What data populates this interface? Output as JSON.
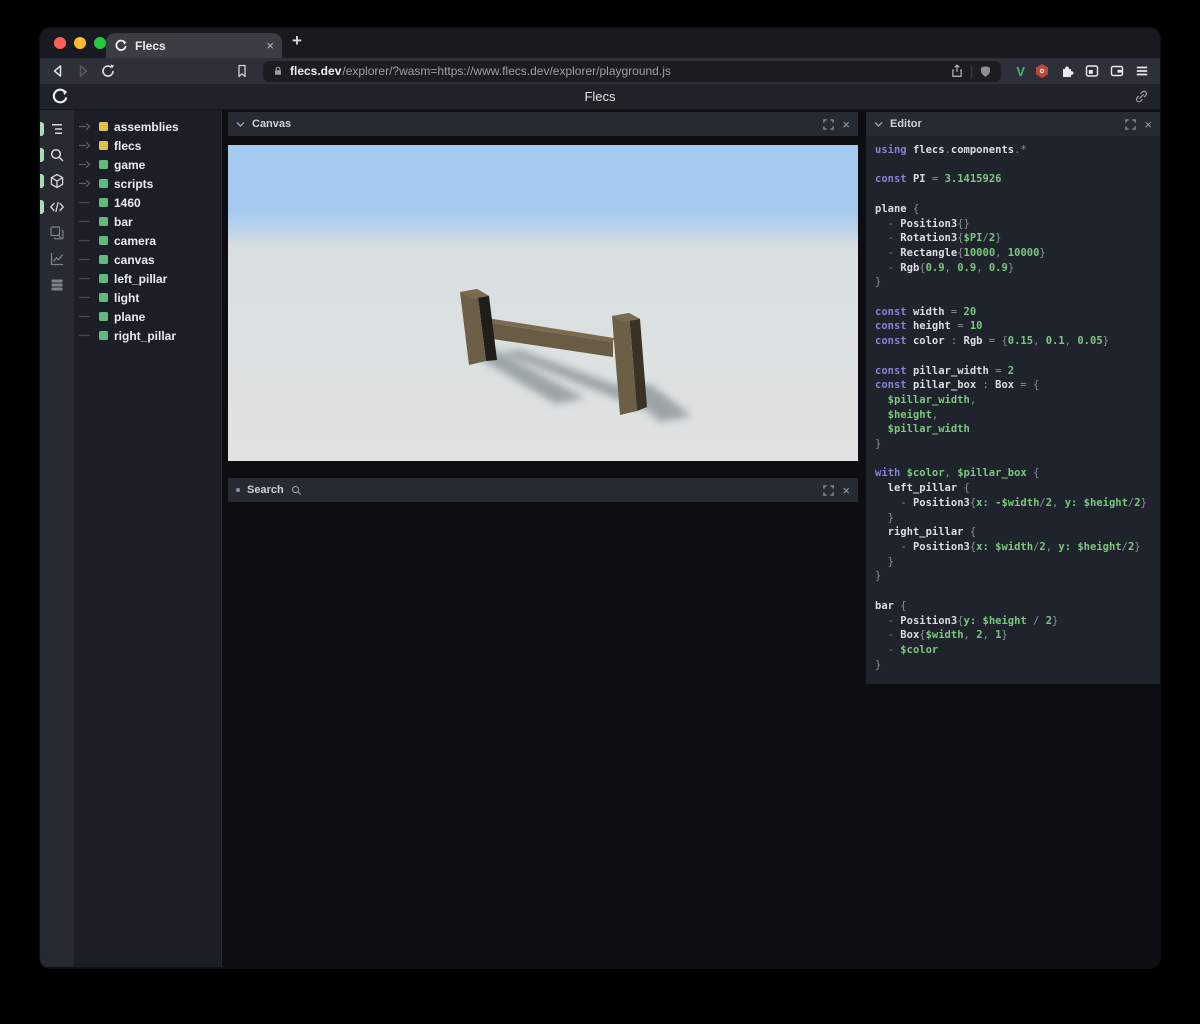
{
  "browser": {
    "tab_title": "Flecs",
    "tab_close": "×",
    "new_tab": "+",
    "url_domain": "flecs.dev",
    "url_rest": "/explorer/?wasm=https://www.flecs.dev/explorer/playground.js",
    "url_divider": "|",
    "vue_badge": "V",
    "icons": [
      "back",
      "forward",
      "reload",
      "bookmark",
      "lock",
      "share",
      "shield",
      "vue-devtools",
      "adblock-extension",
      "extensions-puzzle",
      "sidebar",
      "wallet",
      "menu"
    ],
    "traffic_lights": {
      "close": "#ff5f57",
      "minimize": "#febc2e",
      "zoom": "#28c840"
    }
  },
  "header": {
    "title": "Flecs",
    "icons": [
      "flecs-logo",
      "link"
    ]
  },
  "rail": {
    "items": [
      {
        "name": "tree-outline",
        "active": true
      },
      {
        "name": "search",
        "active": true
      },
      {
        "name": "cube",
        "active": true
      },
      {
        "name": "code",
        "active": true
      },
      {
        "name": "inspect",
        "active": false
      },
      {
        "name": "chart",
        "active": false
      },
      {
        "name": "rows",
        "active": false
      }
    ]
  },
  "tree": {
    "items": [
      {
        "label": "assemblies",
        "square": "#e2c04c",
        "expandable": true
      },
      {
        "label": "flecs",
        "square": "#e2c04c",
        "expandable": true
      },
      {
        "label": "game",
        "square": "#61ba7c",
        "expandable": true
      },
      {
        "label": "scripts",
        "square": "#61ba7c",
        "expandable": true
      },
      {
        "label": "1460",
        "square": "#61ba7c",
        "expandable": false
      },
      {
        "label": "bar",
        "square": "#61ba7c",
        "expandable": false
      },
      {
        "label": "camera",
        "square": "#61ba7c",
        "expandable": false
      },
      {
        "label": "canvas",
        "square": "#61ba7c",
        "expandable": false
      },
      {
        "label": "left_pillar",
        "square": "#61ba7c",
        "expandable": false
      },
      {
        "label": "light",
        "square": "#61ba7c",
        "expandable": false
      },
      {
        "label": "plane",
        "square": "#61ba7c",
        "expandable": false
      },
      {
        "label": "right_pillar",
        "square": "#61ba7c",
        "expandable": false
      }
    ]
  },
  "panels": {
    "canvas_title": "Canvas",
    "search_title": "Search",
    "editor_title": "Editor",
    "close_glyph": "×",
    "header_icons": [
      "chevron-down",
      "fullscreen",
      "close",
      "magnifier"
    ]
  },
  "scene": {
    "sky": "#a5caf0",
    "ground": "#dde2e0",
    "wood_front": "#6c5f47",
    "wood_dark": "#201e18",
    "wood_side": "#393325",
    "wood_top": "#7a6b50",
    "shadow": "#5b6670"
  },
  "code": {
    "colors": {
      "keyword": "#8583d6",
      "identifier": "#dcdde2",
      "punct": "#8b909a",
      "value": "#7cc87f"
    },
    "lines": [
      [
        [
          "k",
          "using "
        ],
        [
          "i",
          "flecs"
        ],
        [
          "o",
          "."
        ],
        [
          "i",
          "components"
        ],
        [
          "o",
          ".*"
        ]
      ],
      [],
      [
        [
          "k",
          "const "
        ],
        [
          "i",
          "PI"
        ],
        [
          "o",
          " = "
        ],
        [
          "g",
          "3.1415926"
        ]
      ],
      [],
      [
        [
          "i",
          "plane"
        ],
        [
          "o",
          " {"
        ]
      ],
      [
        [
          "o",
          "  - "
        ],
        [
          "i",
          "Position3"
        ],
        [
          "o",
          "{}"
        ]
      ],
      [
        [
          "o",
          "  - "
        ],
        [
          "i",
          "Rotation3"
        ],
        [
          "o",
          "{"
        ],
        [
          "g",
          "$PI"
        ],
        [
          "o",
          "/"
        ],
        [
          "g",
          "2"
        ],
        [
          "o",
          "}"
        ]
      ],
      [
        [
          "o",
          "  - "
        ],
        [
          "i",
          "Rectangle"
        ],
        [
          "o",
          "{"
        ],
        [
          "g",
          "10000"
        ],
        [
          "o",
          ", "
        ],
        [
          "g",
          "10000"
        ],
        [
          "o",
          "}"
        ]
      ],
      [
        [
          "o",
          "  - "
        ],
        [
          "i",
          "Rgb"
        ],
        [
          "o",
          "{"
        ],
        [
          "g",
          "0.9"
        ],
        [
          "o",
          ", "
        ],
        [
          "g",
          "0.9"
        ],
        [
          "o",
          ", "
        ],
        [
          "g",
          "0.9"
        ],
        [
          "o",
          "}"
        ]
      ],
      [
        [
          "o",
          "}"
        ]
      ],
      [],
      [
        [
          "k",
          "const "
        ],
        [
          "i",
          "width"
        ],
        [
          "o",
          " = "
        ],
        [
          "g",
          "20"
        ]
      ],
      [
        [
          "k",
          "const "
        ],
        [
          "i",
          "height"
        ],
        [
          "o",
          " = "
        ],
        [
          "g",
          "10"
        ]
      ],
      [
        [
          "k",
          "const "
        ],
        [
          "i",
          "color"
        ],
        [
          "o",
          " : "
        ],
        [
          "i",
          "Rgb"
        ],
        [
          "o",
          " = {"
        ],
        [
          "g",
          "0.15"
        ],
        [
          "o",
          ", "
        ],
        [
          "g",
          "0.1"
        ],
        [
          "o",
          ", "
        ],
        [
          "g",
          "0.05"
        ],
        [
          "o",
          "}"
        ]
      ],
      [],
      [
        [
          "k",
          "const "
        ],
        [
          "i",
          "pillar_width"
        ],
        [
          "o",
          " = "
        ],
        [
          "g",
          "2"
        ]
      ],
      [
        [
          "k",
          "const "
        ],
        [
          "i",
          "pillar_box"
        ],
        [
          "o",
          " : "
        ],
        [
          "i",
          "Box"
        ],
        [
          "o",
          " = {"
        ]
      ],
      [
        [
          "g",
          "  $pillar_width"
        ],
        [
          "o",
          ","
        ]
      ],
      [
        [
          "g",
          "  $height"
        ],
        [
          "o",
          ","
        ]
      ],
      [
        [
          "g",
          "  $pillar_width"
        ]
      ],
      [
        [
          "o",
          "}"
        ]
      ],
      [],
      [
        [
          "k",
          "with "
        ],
        [
          "g",
          "$color"
        ],
        [
          "o",
          ", "
        ],
        [
          "g",
          "$pillar_box"
        ],
        [
          "o",
          " {"
        ]
      ],
      [
        [
          "i",
          "  left_pillar"
        ],
        [
          "o",
          " {"
        ]
      ],
      [
        [
          "o",
          "    - "
        ],
        [
          "i",
          "Position3"
        ],
        [
          "o",
          "{"
        ],
        [
          "g",
          "x: -$width"
        ],
        [
          "o",
          "/"
        ],
        [
          "g",
          "2"
        ],
        [
          "o",
          ", "
        ],
        [
          "g",
          "y: $height"
        ],
        [
          "o",
          "/"
        ],
        [
          "g",
          "2"
        ],
        [
          "o",
          "}"
        ]
      ],
      [
        [
          "o",
          "  }"
        ]
      ],
      [
        [
          "i",
          "  right_pillar"
        ],
        [
          "o",
          " {"
        ]
      ],
      [
        [
          "o",
          "    - "
        ],
        [
          "i",
          "Position3"
        ],
        [
          "o",
          "{"
        ],
        [
          "g",
          "x: $width"
        ],
        [
          "o",
          "/"
        ],
        [
          "g",
          "2"
        ],
        [
          "o",
          ", "
        ],
        [
          "g",
          "y: $height"
        ],
        [
          "o",
          "/"
        ],
        [
          "g",
          "2"
        ],
        [
          "o",
          "}"
        ]
      ],
      [
        [
          "o",
          "  }"
        ]
      ],
      [
        [
          "o",
          "}"
        ]
      ],
      [],
      [
        [
          "i",
          "bar"
        ],
        [
          "o",
          " {"
        ]
      ],
      [
        [
          "o",
          "  - "
        ],
        [
          "i",
          "Position3"
        ],
        [
          "o",
          "{"
        ],
        [
          "g",
          "y: $height"
        ],
        [
          "o",
          " / "
        ],
        [
          "g",
          "2"
        ],
        [
          "o",
          "}"
        ]
      ],
      [
        [
          "o",
          "  - "
        ],
        [
          "i",
          "Box"
        ],
        [
          "o",
          "{"
        ],
        [
          "g",
          "$width"
        ],
        [
          "o",
          ", "
        ],
        [
          "g",
          "2"
        ],
        [
          "o",
          ", "
        ],
        [
          "g",
          "1"
        ],
        [
          "o",
          "}"
        ]
      ],
      [
        [
          "o",
          "  - "
        ],
        [
          "g",
          "$color"
        ]
      ],
      [
        [
          "o",
          "}"
        ]
      ]
    ]
  }
}
